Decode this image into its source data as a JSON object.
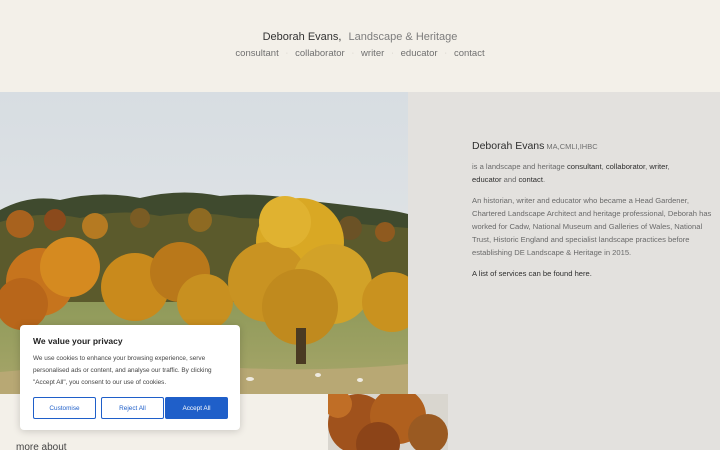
{
  "header": {
    "name": "Deborah Evans",
    "comma": ",",
    "tagline": "Landscape & Heritage",
    "nav": [
      "consultant",
      "collaborator",
      "writer",
      "educator",
      "contact"
    ],
    "separator": "·"
  },
  "intro": {
    "name": "Deborah Evans",
    "quals": "MA,CMLI,IHBC",
    "p1": {
      "pre": "is a landscape and heritage ",
      "consultant": "consultant",
      "c1": ", ",
      "collaborator": "collaborator",
      "c2": ", ",
      "writer": "writer",
      "c3": ",",
      "educator": "educator",
      "and": " and ",
      "contact": "contact",
      "end": "."
    },
    "p2": "An historian, writer and educator who became a Head Gardener, Chartered Landscape Architect and heritage professional, Deborah has worked for Cadw, National Museum and Galleries of Wales, National Trust, Historic England and specialist landscape practices before establishing DE Landscape & Heritage in 2015.",
    "p3": "A list of services can be found here."
  },
  "bottom": {
    "more_about": "more about"
  },
  "cookie": {
    "title": "We value your privacy",
    "text": "We use cookies to enhance your browsing experience, serve personalised ads or content, and analyse our traffic. By clicking \"Accept All\", you consent to our use of cookies.",
    "customise": "Customise",
    "reject": "Reject All",
    "accept": "Accept All"
  },
  "colors": {
    "background": "#f3f0e9",
    "panel": "#e3e1de",
    "accent": "#1f5fc9"
  }
}
